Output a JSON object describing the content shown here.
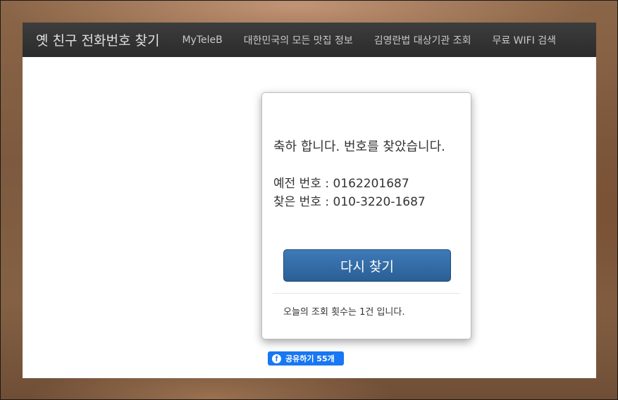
{
  "navbar": {
    "brand": "옛 친구 전화번호 찾기",
    "items": [
      {
        "label": "MyTeleB"
      },
      {
        "label": "대한민국의 모든 맛집 정보"
      },
      {
        "label": "김영란법 대상기관 조회"
      },
      {
        "label": "무료 WIFI 검색"
      }
    ]
  },
  "result": {
    "message": "축하 합니다. 번호를 찾았습니다.",
    "old_number_label": "예전 번호 : ",
    "old_number": "0162201687",
    "new_number_label": "찾은 번호 : ",
    "new_number": "010-3220-1687",
    "retry_label": "다시 찾기",
    "count_text": "오늘의 조회 횟수는 1건 입니다."
  },
  "share": {
    "icon": "facebook-icon",
    "label": "공유하기 55개"
  },
  "colors": {
    "navbar": "#2e2e2e",
    "button": "#2b5f95",
    "facebook": "#1877f2"
  }
}
